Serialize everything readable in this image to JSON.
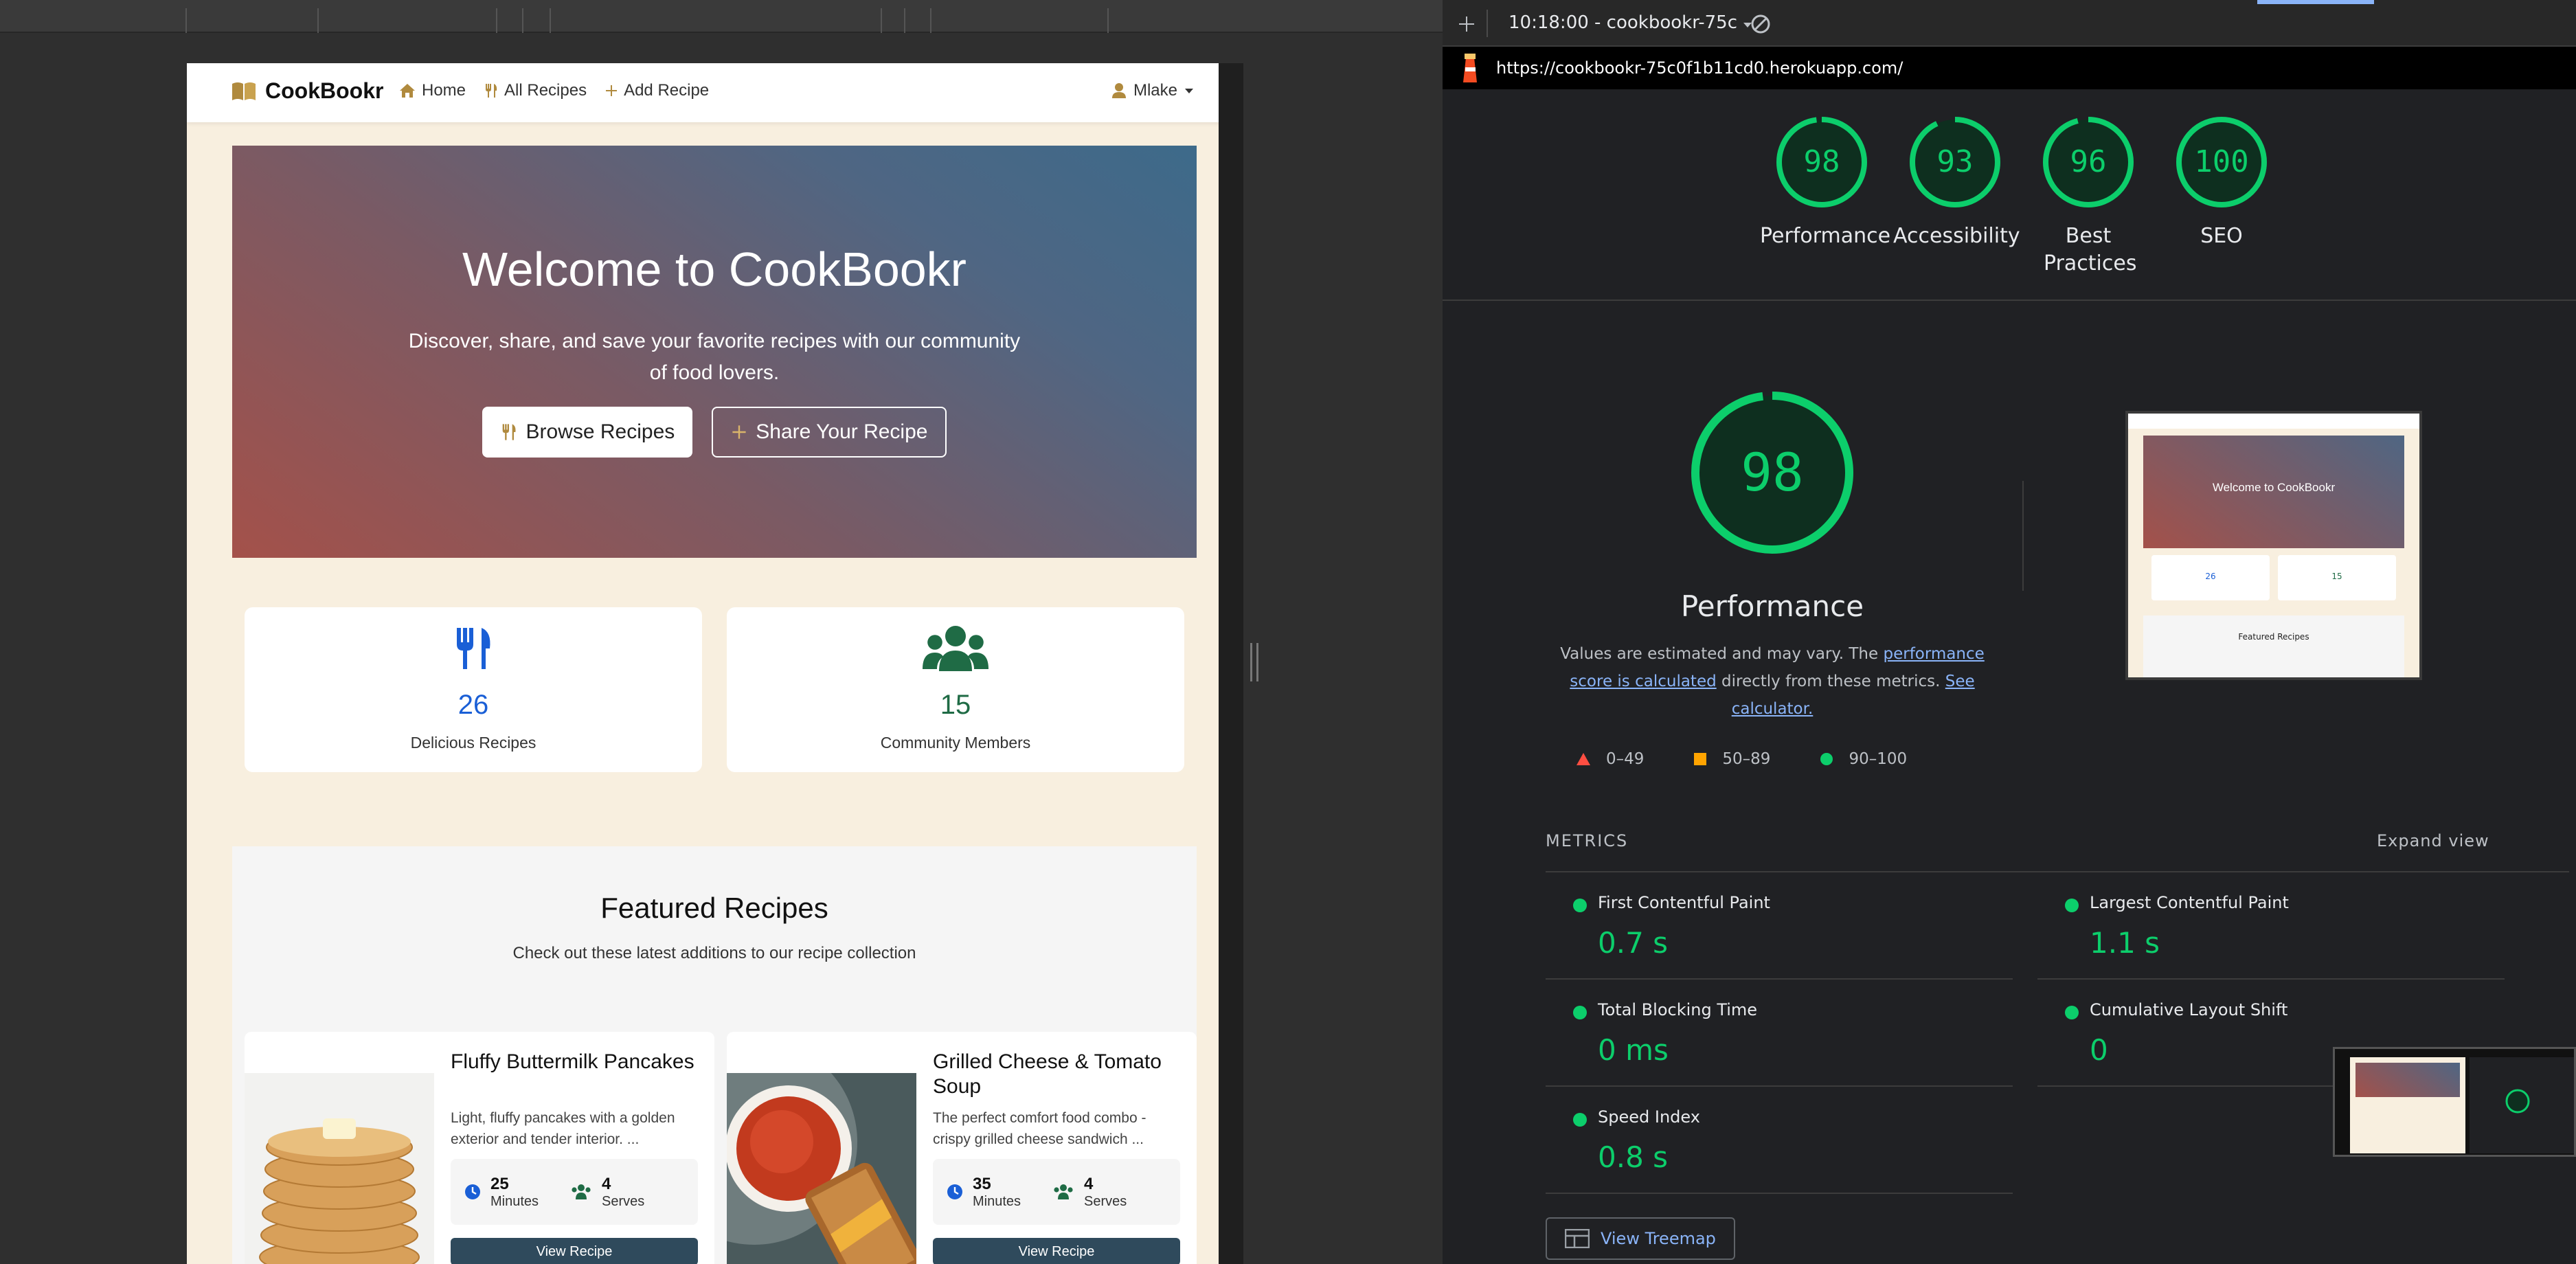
{
  "devtools": {
    "tab_label": "10:18:00 - cookbookr-75c",
    "url": "https://cookbookr-75c0f1b11cd0.herokuapp.com/"
  },
  "site": {
    "brand": "CookBookr",
    "nav": [
      "Home",
      "All Recipes",
      "Add Recipe"
    ],
    "user": "Mlake",
    "hero": {
      "title": "Welcome to CookBookr",
      "subtitle": "Discover, share, and save your favorite recipes with our community of food lovers.",
      "browse_button": "Browse Recipes",
      "share_button": "Share Your Recipe"
    },
    "stats": [
      {
        "value": "26",
        "label": "Delicious Recipes",
        "icon": "utensils-icon",
        "color": "#1a5fd6"
      },
      {
        "value": "15",
        "label": "Community Members",
        "icon": "users-icon",
        "color": "#1f6b45"
      }
    ],
    "featured": {
      "title": "Featured Recipes",
      "subtitle": "Check out these latest additions to our recipe collection",
      "recipes": [
        {
          "title": "Fluffy Buttermilk Pancakes",
          "description": "Light, fluffy pancakes with a golden exterior and tender interior. ...",
          "minutes": "25",
          "minutes_label": "Minutes",
          "serves": "4",
          "serves_label": "Serves",
          "button": "View Recipe"
        },
        {
          "title": "Grilled Cheese & Tomato Soup",
          "description": "The perfect comfort food combo - crispy grilled cheese sandwich ...",
          "minutes": "35",
          "minutes_label": "Minutes",
          "serves": "4",
          "serves_label": "Serves",
          "button": "View Recipe"
        }
      ]
    }
  },
  "lighthouse": {
    "scores": [
      {
        "value": "98",
        "label": "Performance"
      },
      {
        "value": "93",
        "label": "Accessibility"
      },
      {
        "value": "96",
        "label": "Best Practices"
      },
      {
        "value": "100",
        "label": "SEO"
      }
    ],
    "main_score": "98",
    "main_label": "Performance",
    "note_pre": "Values are estimated and may vary. The ",
    "note_link1": "performance score is calculated",
    "note_mid": " directly from these metrics. ",
    "note_link2": "See calculator.",
    "legend": [
      "0–49",
      "50–89",
      "90–100"
    ],
    "metrics_heading": "METRICS",
    "expand_view": "Expand view",
    "metrics": [
      {
        "name": "First Contentful Paint",
        "value": "0.7 s"
      },
      {
        "name": "Largest Contentful Paint",
        "value": "1.1 s"
      },
      {
        "name": "Total Blocking Time",
        "value": "0 ms"
      },
      {
        "name": "Cumulative Layout Shift",
        "value": "0"
      },
      {
        "name": "Speed Index",
        "value": "0.8 s"
      }
    ],
    "view_treemap": "View Treemap",
    "colors": {
      "good": "#0cce6b",
      "average": "#ffa400",
      "poor": "#ff4e42"
    }
  },
  "thumbnail": {
    "title": "Welcome to CookBookr",
    "recipes_count": "26",
    "members_count": "15",
    "featured": "Featured Recipes"
  }
}
